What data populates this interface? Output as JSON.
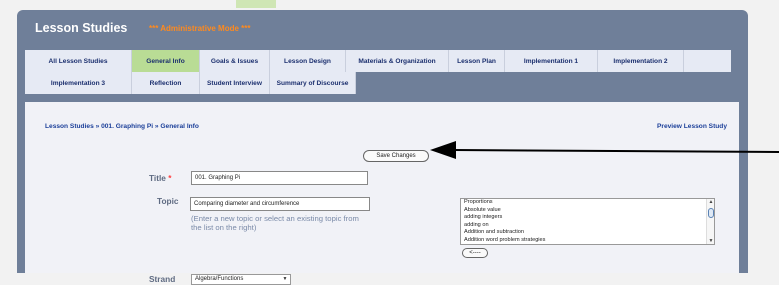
{
  "header": {
    "title": "Lesson Studies",
    "mode": "*** Administrative Mode ***"
  },
  "tabs": [
    {
      "label": "All Lesson Studies",
      "active": false
    },
    {
      "label": "General Info",
      "active": true
    },
    {
      "label": "Goals & Issues",
      "active": false
    },
    {
      "label": "Lesson Design",
      "active": false
    },
    {
      "label": "Materials & Organization",
      "active": false
    },
    {
      "label": "Lesson Plan",
      "active": false
    },
    {
      "label": "Implementation 1",
      "active": false
    },
    {
      "label": "Implementation 2",
      "active": false
    },
    {
      "label": "Implementation 3",
      "active": false
    },
    {
      "label": "Reflection",
      "active": false
    },
    {
      "label": "Student Interview",
      "active": false
    },
    {
      "label": "Summary of Discourse",
      "active": false
    }
  ],
  "breadcrumb": "Lesson Studies » 001. Graphing Pi » General Info",
  "preview_link": "Preview Lesson Study",
  "save_button": "Save Changes",
  "form": {
    "title_label": "Title",
    "title_required": "*",
    "title_value": "001. Graphing Pi",
    "topic_label": "Topic",
    "topic_value": "Comparing diameter and circumference",
    "topic_hint": "(Enter a new topic or select an existing topic from the list on the right)",
    "topic_options": [
      "Proportions",
      "Absolute value",
      "adding integers",
      "adding on",
      "Addition and subtraction",
      "Addition word problem strategies"
    ],
    "add_topic_button": "<----",
    "strand_label": "Strand",
    "strand_value": "Algebra/Functions"
  },
  "colors": {
    "panel": "#6f7f99",
    "tab": "#e6eaf4",
    "tab_active": "#b9dc95",
    "admin_mode": "#ff8a1e",
    "link": "#1b3f99"
  }
}
